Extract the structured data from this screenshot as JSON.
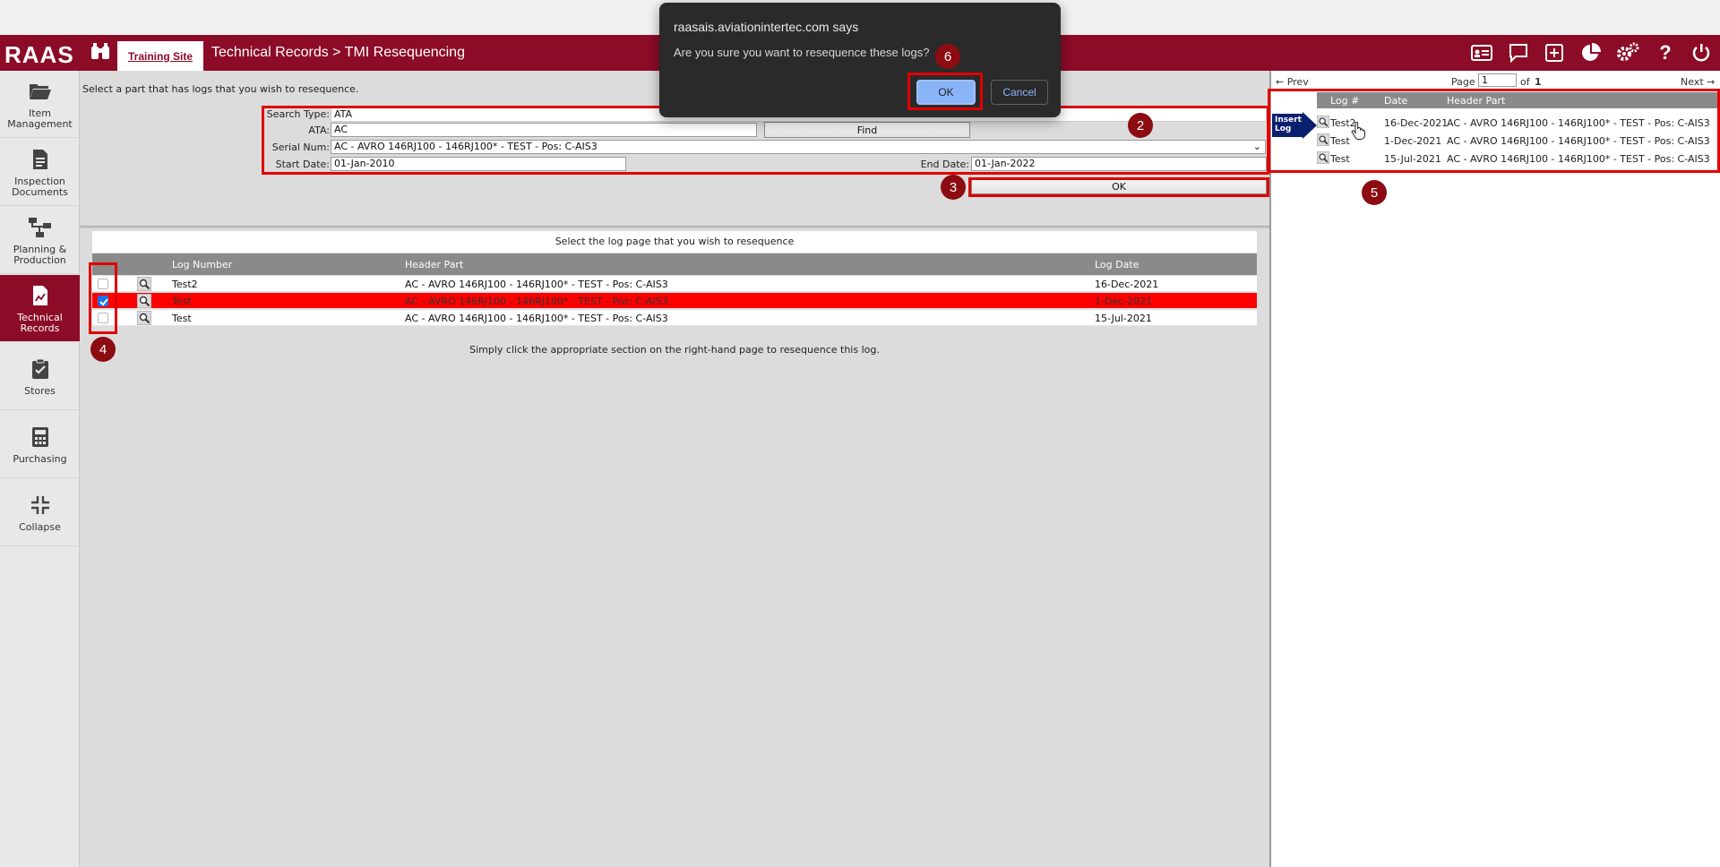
{
  "header": {
    "logo": "RAAS",
    "site_tab": "Training Site",
    "breadcrumb": "Technical Records > TMI Resequencing",
    "icons": [
      "id-card-icon",
      "comment-icon",
      "plus-square-icon",
      "pie-chart-icon",
      "gears-icon",
      "help-icon",
      "power-icon"
    ]
  },
  "sidebar": {
    "items": [
      {
        "label": "Item Management",
        "icon": "folder-open-icon"
      },
      {
        "label": "Inspection Documents",
        "icon": "document-icon"
      },
      {
        "label": "Planning & Production",
        "icon": "workflow-icon"
      },
      {
        "label": "Technical Records",
        "icon": "chart-file-icon",
        "active": true
      },
      {
        "label": "Stores",
        "icon": "clipboard-check-icon"
      },
      {
        "label": "Purchasing",
        "icon": "calculator-icon"
      },
      {
        "label": "Collapse",
        "icon": "compress-icon"
      }
    ]
  },
  "main": {
    "instruction": "Select a part that has logs that you wish to resequence.",
    "form": {
      "search_type_label": "Search Type:",
      "search_type_value": "ATA",
      "ata_label": "ATA:",
      "ata_value": "AC",
      "find_label": "Find",
      "serial_label": "Serial Num:",
      "serial_value": "AC - AVRO 146RJ100 - 146RJ100* - TEST - Pos: C-AIS3",
      "start_date_label": "Start Date:",
      "start_date_value": "01-Jan-2010",
      "end_date_label": "End Date:",
      "end_date_value": "01-Jan-2022",
      "ok_label": "OK"
    },
    "log_table": {
      "caption": "Select the log page that you wish to resequence",
      "columns": [
        "Log Number",
        "Header Part",
        "Log Date"
      ],
      "rows": [
        {
          "log_number": "Test2",
          "header_part": "AC - AVRO 146RJ100 - 146RJ100* - TEST - Pos: C-AIS3",
          "log_date": "16-Dec-2021",
          "checked": false
        },
        {
          "log_number": "Test",
          "header_part": "AC - AVRO 146RJ100 - 146RJ100* - TEST - Pos: C-AIS3",
          "log_date": "1-Dec-2021",
          "checked": true
        },
        {
          "log_number": "Test",
          "header_part": "AC - AVRO 146RJ100 - 146RJ100* - TEST - Pos: C-AIS3",
          "log_date": "15-Jul-2021",
          "checked": false
        }
      ]
    },
    "hint": "Simply click the appropriate section on the right-hand page to resequence this log."
  },
  "right_panel": {
    "prev": "← Prev",
    "page_label": "Page",
    "page_value": "1",
    "of_label": "of",
    "page_total": "1",
    "next": "Next →",
    "insert_log": "Insert Log",
    "columns": [
      "Log #",
      "Date",
      "Header Part"
    ],
    "rows": [
      {
        "log": "Test2",
        "date": "16-Dec-2021",
        "header_part": "AC - AVRO 146RJ100 - 146RJ100* - TEST - Pos: C-AIS3"
      },
      {
        "log": "Test",
        "date": "1-Dec-2021",
        "header_part": "AC - AVRO 146RJ100 - 146RJ100* - TEST - Pos: C-AIS3"
      },
      {
        "log": "Test",
        "date": "15-Jul-2021",
        "header_part": "AC - AVRO 146RJ100 - 146RJ100* - TEST - Pos: C-AIS3"
      }
    ]
  },
  "dialog": {
    "title": "raasais.aviationintertec.com says",
    "message": "Are you sure you want to resequence these logs?",
    "ok": "OK",
    "cancel": "Cancel"
  },
  "annotations": {
    "badge_2": "2",
    "badge_3": "3",
    "badge_4": "4",
    "badge_5": "5",
    "badge_6": "6"
  },
  "colors": {
    "brand": "#8c0c28",
    "selected_row": "#ff0000",
    "annotation_box": "#e00000",
    "dialog_bg": "#2a2a2a",
    "dialog_ok": "#8ab4f8"
  }
}
